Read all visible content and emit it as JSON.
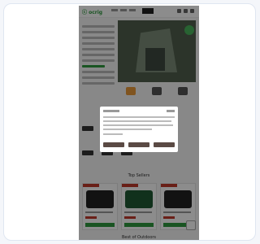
{
  "site": {
    "logo_text": "ⓒ ocrig"
  },
  "sections": {
    "top_sellers_title": "Top Sellers",
    "bottom_title": "Best of Outdoors"
  }
}
